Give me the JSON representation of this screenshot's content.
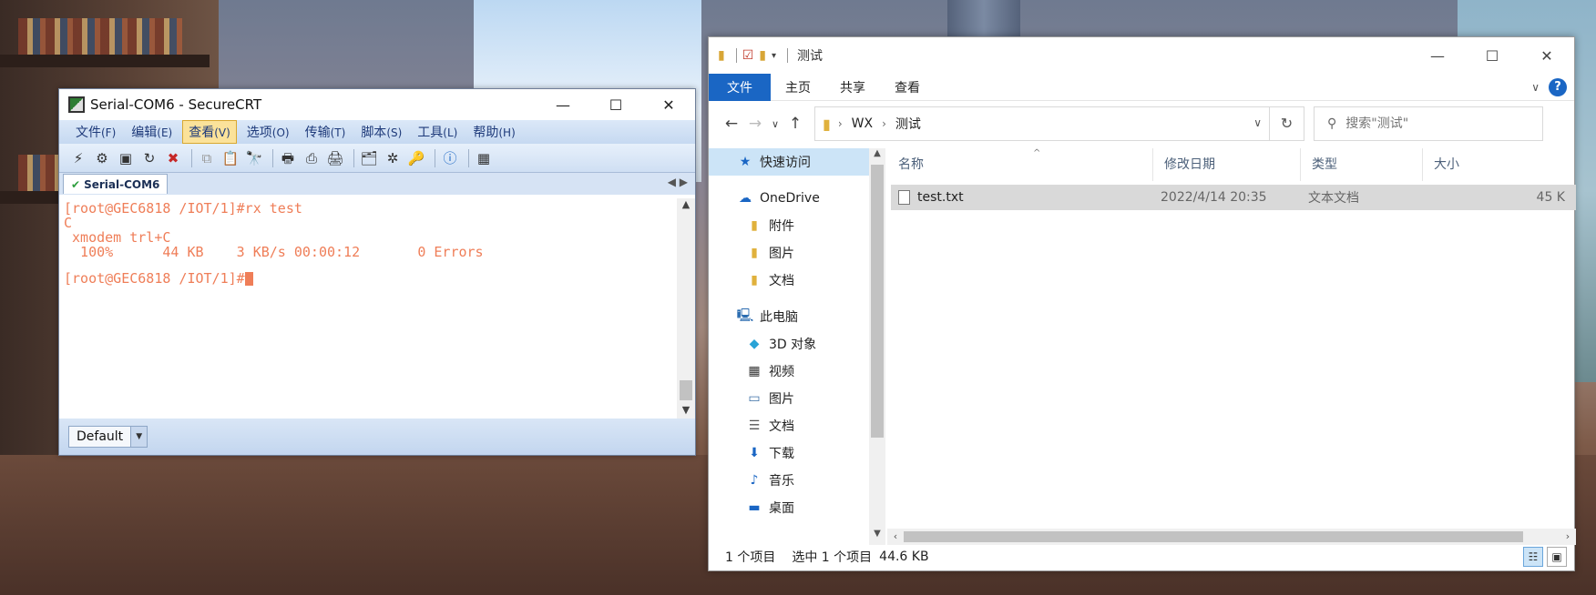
{
  "securecrt": {
    "title": "Serial-COM6 - SecureCRT",
    "window_controls": {
      "minimize": "—",
      "maximize": "☐",
      "close": "✕"
    },
    "menu": [
      {
        "label": "文件",
        "key": "(F)"
      },
      {
        "label": "编辑",
        "key": "(E)"
      },
      {
        "label": "查看",
        "key": "(V)"
      },
      {
        "label": "选项",
        "key": "(O)"
      },
      {
        "label": "传输",
        "key": "(T)"
      },
      {
        "label": "脚本",
        "key": "(S)"
      },
      {
        "label": "工具",
        "key": "(L)"
      },
      {
        "label": "帮助",
        "key": "(H)"
      }
    ],
    "tab": {
      "label": "Serial-COM6",
      "check": "✔"
    },
    "tab_arrows": "◀ ▶",
    "terminal_lines": [
      "[root@GEC6818 /IOT/1]#rx test",
      "C",
      " xmodem trl+C ",
      "  100%      44 KB    3 KB/s 00:00:12       0 Errors",
      "",
      "[root@GEC6818 /IOT/1]#"
    ],
    "session_select": "Default",
    "colors": {
      "terminal_text": "#ef7e58",
      "menu_active": "#fbe29a"
    }
  },
  "explorer": {
    "title": "测试",
    "window_controls": {
      "minimize": "—",
      "maximize": "☐",
      "close": "✕"
    },
    "ribbon": {
      "file": "文件",
      "tabs": [
        "主页",
        "共享",
        "查看"
      ],
      "help": "?"
    },
    "breadcrumb": [
      "WX",
      "测试"
    ],
    "search_placeholder": "搜索\"测试\"",
    "nav": {
      "quick_access": "快速访问",
      "onedrive": "OneDrive",
      "onedrive_items": [
        "附件",
        "图片",
        "文档"
      ],
      "this_pc": "此电脑",
      "pc_items": [
        {
          "label": "3D 对象",
          "icon": "cube-icon"
        },
        {
          "label": "视频",
          "icon": "video-icon"
        },
        {
          "label": "图片",
          "icon": "pictures-icon"
        },
        {
          "label": "文档",
          "icon": "documents-icon"
        },
        {
          "label": "下载",
          "icon": "download-icon"
        },
        {
          "label": "音乐",
          "icon": "music-icon"
        },
        {
          "label": "桌面",
          "icon": "desktop-icon"
        }
      ]
    },
    "columns": [
      "名称",
      "修改日期",
      "类型",
      "大小"
    ],
    "files": [
      {
        "name": "test.txt",
        "modified": "2022/4/14 20:35",
        "type": "文本文档",
        "size": "45 K"
      }
    ],
    "status": {
      "count": "1 个项目",
      "selected": "选中 1 个项目",
      "size": "44.6 KB"
    },
    "colors": {
      "accent": "#1a66c4",
      "selection": "#cce4f7"
    }
  }
}
